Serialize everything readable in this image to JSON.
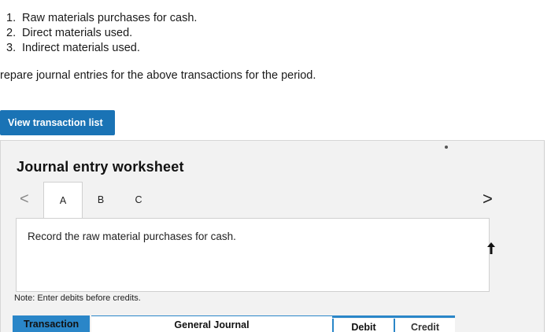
{
  "transactions": [
    {
      "num": "1.",
      "text": "Raw materials purchases for cash."
    },
    {
      "num": "2.",
      "text": "Direct materials used."
    },
    {
      "num": "3.",
      "text": "Indirect materials used."
    }
  ],
  "instruction": "repare journal entries for the above transactions for the period.",
  "view_button_label": "View transaction list",
  "worksheet": {
    "title": "Journal entry worksheet",
    "prev_icon": "chevron-left-icon",
    "next_icon": "chevron-right-icon",
    "prev_glyph": "<",
    "next_glyph": ">",
    "tabs": [
      {
        "label": "A",
        "active": true
      },
      {
        "label": "B",
        "active": false
      },
      {
        "label": "C",
        "active": false
      }
    ],
    "prompt": "Record the raw material purchases for cash.",
    "note": "Note: Enter debits before credits.",
    "table_headers": {
      "transaction": "Transaction",
      "general_journal": "General Journal",
      "debit": "Debit",
      "credit": "Credit"
    }
  },
  "colors": {
    "accent": "#1a73b5",
    "header_blue": "#2a86c8",
    "panel_bg": "#f2f2f2"
  }
}
